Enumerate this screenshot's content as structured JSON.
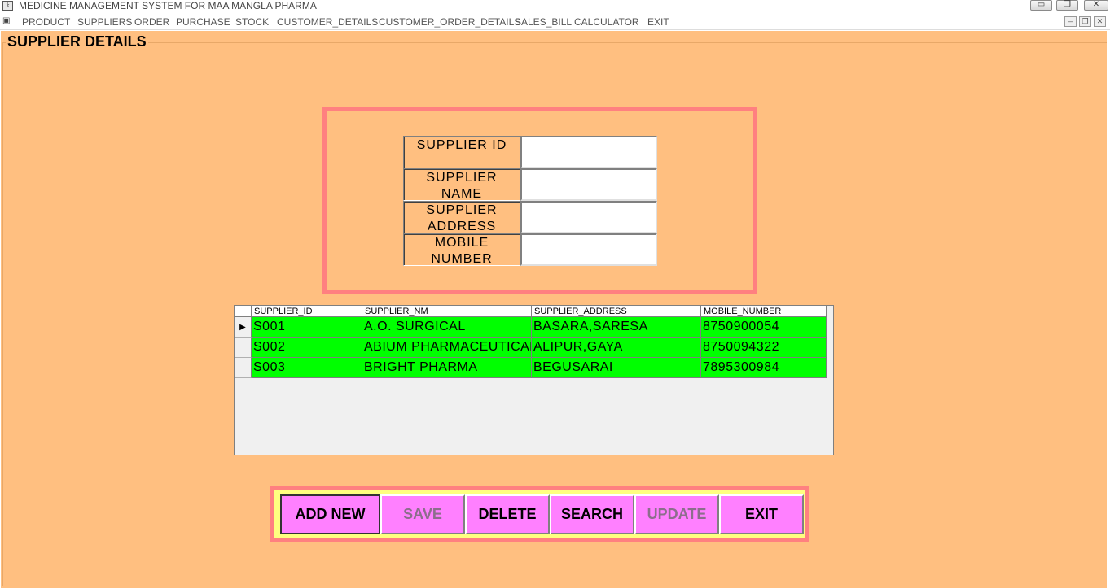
{
  "window": {
    "title": "MEDICINE MANAGEMENT SYSTEM FOR MAA MANGLA PHARMA",
    "controls": {
      "minimize": "▭",
      "restore": "❐",
      "close": "✕"
    }
  },
  "menu": {
    "items": [
      "PRODUCT",
      "SUPPLIERS",
      "ORDER",
      "PURCHASE",
      "STOCK",
      "CUSTOMER_DETAILS",
      "CUSTOMER_ORDER_DETAILS",
      "SALES_BILL",
      "CALCULATOR",
      "EXIT"
    ],
    "mdi_controls": {
      "minimize": "–",
      "restore": "❐",
      "close": "✕"
    }
  },
  "form": {
    "title": "SUPPLIER DETAILS",
    "fields": [
      {
        "label": "SUPPLIER ID",
        "value": ""
      },
      {
        "label": "SUPPLIER NAME",
        "value": ""
      },
      {
        "label": "SUPPLIER ADDRESS",
        "value": ""
      },
      {
        "label": "MOBILE NUMBER",
        "value": ""
      }
    ]
  },
  "grid": {
    "columns": [
      "SUPPLIER_ID",
      "SUPPLIER_NM",
      "SUPPLIER_ADDRESS",
      "MOBILE_NUMBER"
    ],
    "current_row_marker": "▶",
    "rows": [
      [
        "S001",
        "A.O. SURGICAL",
        "BASARA,SARESA",
        "8750900054"
      ],
      [
        "S002",
        "ABIUM PHARMACEUTICAL",
        "ALIPUR,GAYA",
        "8750094322"
      ],
      [
        "S003",
        "BRIGHT PHARMA",
        "BEGUSARAI",
        "7895300984"
      ]
    ]
  },
  "buttons": {
    "add_new": "ADD NEW",
    "save": "SAVE",
    "delete": "DELETE",
    "search": "SEARCH",
    "update": "UPDATE",
    "exit": "EXIT"
  },
  "colors": {
    "form_background": "#ffbf80",
    "frame_border": "#ff8080",
    "grid_row_fill": "#00ff00",
    "button_fill": "#ff80ff",
    "button_panel": "#ffff80"
  }
}
